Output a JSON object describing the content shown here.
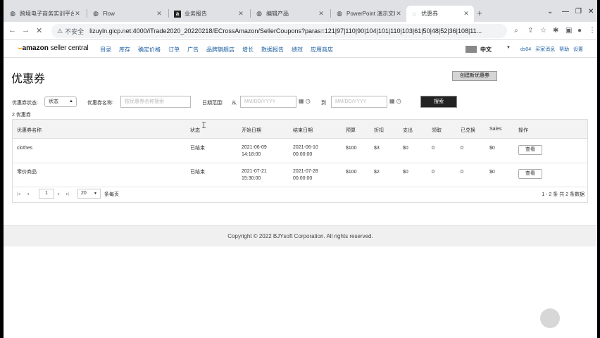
{
  "browser": {
    "tabs": [
      {
        "title": "跨境电子商务实训平台",
        "icon": "globe-icon"
      },
      {
        "title": "Flow",
        "icon": "globe-icon"
      },
      {
        "title": "业务报告",
        "icon": "amazon-icon"
      },
      {
        "title": "编辑产品",
        "icon": "globe-icon"
      },
      {
        "title": "PowerPoint 演示文稿",
        "icon": "globe-icon"
      },
      {
        "title": "优惠券",
        "icon": "loading-icon",
        "active": true
      }
    ],
    "address": {
      "security": "不安全",
      "url": "lizuyln.gicp.net:4000/iTrade2020_20220218/ECrossAmazon/SellerCoupons?paras=121|97|110|90|104|101|110|103|61|50|48|52|36|108|11..."
    }
  },
  "appnav": {
    "logo_brand": "amazon",
    "logo_product": "seller central",
    "menu": [
      "目录",
      "库存",
      "确定价格",
      "订单",
      "广告",
      "品牌旗舰店",
      "增长",
      "数据报告",
      "绩效",
      "应用商店"
    ],
    "language": "中文",
    "user_links": [
      "ds04",
      "买家消息",
      "帮助",
      "设置"
    ]
  },
  "page": {
    "title": "优惠券",
    "create_button": "创建新优惠券",
    "filters": {
      "status_label": "优惠券状态:",
      "status_value": "状态",
      "name_label": "优惠券名称:",
      "name_placeholder": "按优惠券名称搜索",
      "date_label": "日期范围:",
      "from_label": "从",
      "to_label": "到",
      "date_placeholder": "MM/DD/YYYY",
      "search_button": "搜索"
    },
    "count": "2 优惠券",
    "table": {
      "headers": [
        "优惠券名称",
        "状态",
        "开始日期",
        "结束日期",
        "预算",
        "折扣",
        "支出",
        "领取",
        "已兑换",
        "Sales",
        "操作"
      ],
      "rows": [
        {
          "name": "clothes",
          "status": "已结束",
          "start_date": "2021-06-09",
          "start_time": "14:18:00",
          "end_date": "2021-06-10",
          "end_time": "00:00:00",
          "budget": "$100",
          "discount": "$3",
          "spend": "$0",
          "clipped": "0",
          "redeemed": "0",
          "sales": "$0",
          "action": "查看"
        },
        {
          "name": "零价商品",
          "status": "已结束",
          "start_date": "2021-07-21",
          "start_time": "15:30:00",
          "end_date": "2021-07-28",
          "end_time": "00:00:00",
          "budget": "$100",
          "discount": "$2",
          "spend": "$0",
          "clipped": "0",
          "redeemed": "0",
          "sales": "$0",
          "action": "查看"
        }
      ]
    },
    "pager": {
      "current_page": "1",
      "per_page": "20",
      "per_page_label": "条每页",
      "range_text": "1 - 2 条   共 2 条数据"
    }
  },
  "footer": {
    "copyright": "Copyright © 2022 BJYsoft Corporation. All rights reserved."
  }
}
